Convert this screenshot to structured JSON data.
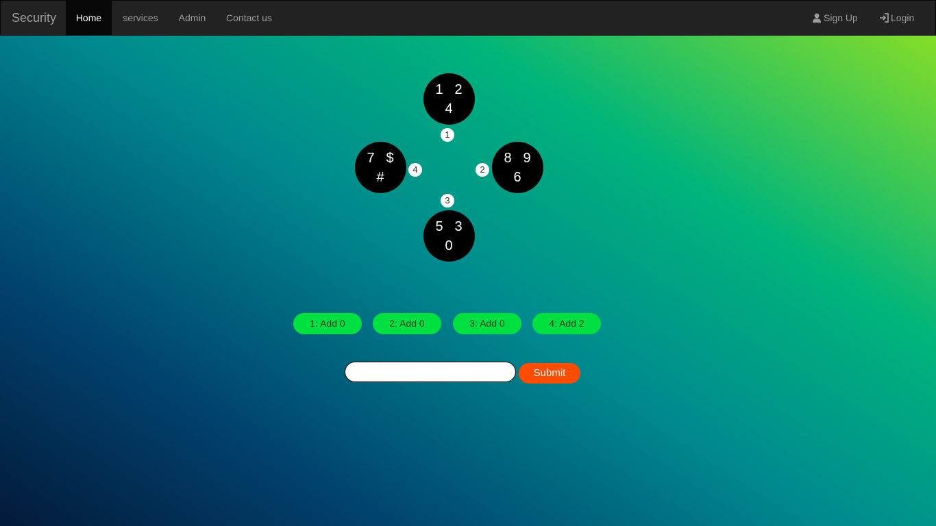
{
  "navbar": {
    "brand": "Security",
    "items": [
      "Home",
      "services",
      "Admin",
      "Contact us"
    ],
    "active_item": "Home",
    "signup_label": "Sign Up",
    "login_label": "Login"
  },
  "dials": {
    "top": [
      "1",
      "2",
      "4"
    ],
    "left": [
      "7",
      "$",
      "#"
    ],
    "right": [
      "8",
      "9",
      "6"
    ],
    "bottom": [
      "5",
      "3",
      "0"
    ]
  },
  "markers": {
    "top": "1",
    "right": "2",
    "bottom": "3",
    "left": "4"
  },
  "add_buttons": [
    "1: Add 0",
    "2: Add 0",
    "3: Add 0",
    "4: Add 2"
  ],
  "form": {
    "input_value": "",
    "submit_label": "Submit"
  },
  "colors": {
    "navbar_bg": "#222222",
    "add_button": "#00e040",
    "submit_button": "#ff4d00"
  }
}
